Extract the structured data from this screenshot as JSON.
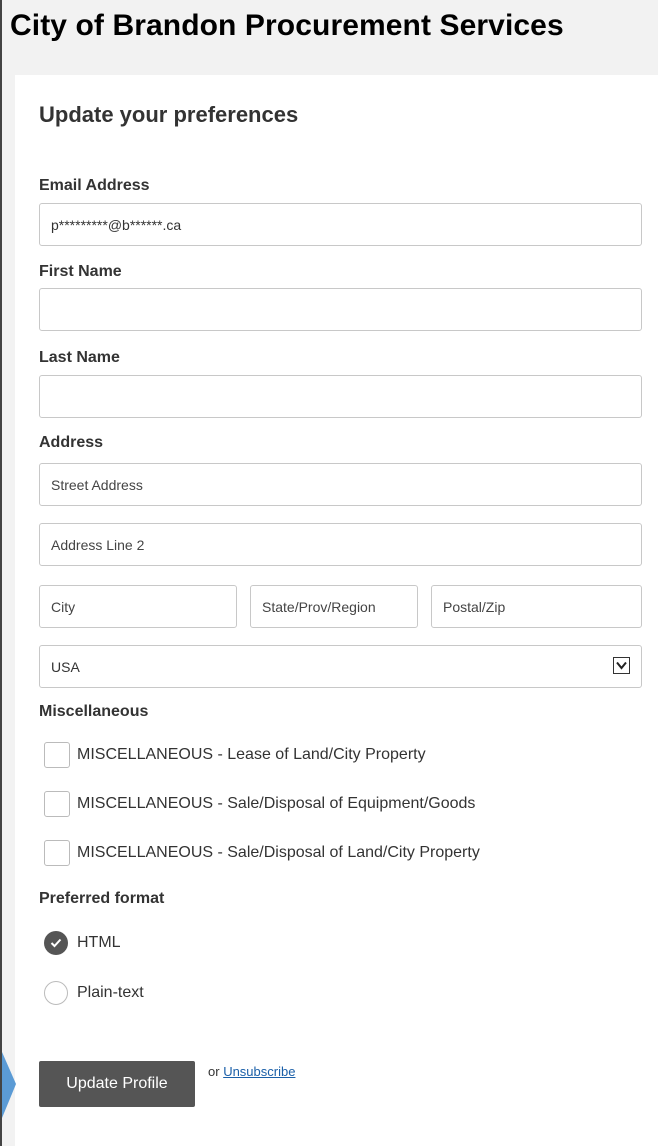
{
  "header": {
    "site_title": "City of Brandon Procurement Services"
  },
  "form": {
    "title": "Update your preferences",
    "email": {
      "label": "Email Address",
      "value": "p*********@b******.ca"
    },
    "first_name": {
      "label": "First Name",
      "value": ""
    },
    "last_name": {
      "label": "Last Name",
      "value": ""
    },
    "address": {
      "label": "Address",
      "street_placeholder": "Street Address",
      "line2_placeholder": "Address Line 2",
      "city_placeholder": "City",
      "state_placeholder": "State/Prov/Region",
      "zip_placeholder": "Postal/Zip",
      "country": "USA"
    },
    "miscellaneous": {
      "label": "Miscellaneous",
      "options": [
        {
          "label": "MISCELLANEOUS - Lease of Land/City Property",
          "checked": false
        },
        {
          "label": "MISCELLANEOUS - Sale/Disposal of Equipment/Goods",
          "checked": false
        },
        {
          "label": "MISCELLANEOUS - Sale/Disposal of Land/City Property",
          "checked": false
        }
      ]
    },
    "format": {
      "label": "Preferred format",
      "options": [
        {
          "label": "HTML",
          "selected": true
        },
        {
          "label": "Plain-text",
          "selected": false
        }
      ]
    },
    "submit_label": "Update Profile",
    "or_text": "or",
    "unsubscribe_label": "Unsubscribe"
  },
  "colors": {
    "background": "#f2f2f2",
    "card": "#ffffff",
    "button": "#555555",
    "link": "#1a5fa8",
    "pointer_arrow": "#5b9bd5"
  },
  "icons": {
    "select_arrow": "chevron-down-icon",
    "radio_checked": "checkmark-icon",
    "pointer": "arrow-pointer-icon"
  }
}
